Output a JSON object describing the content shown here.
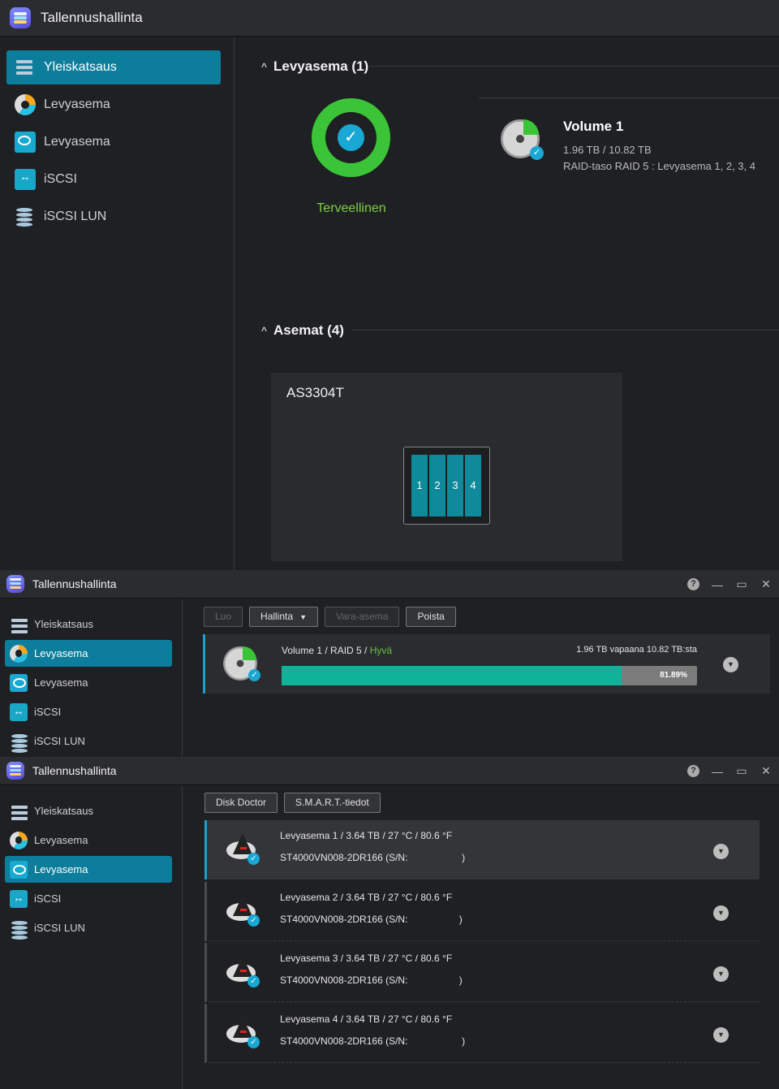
{
  "app_title": "Tallennushallinta",
  "nav": [
    "Yleiskatsaus",
    "Levyasema",
    "Levyasema",
    "iSCSI",
    "iSCSI LUN"
  ],
  "overview": {
    "volumes_header": "Levyasema (1)",
    "health_label": "Terveellinen",
    "volume_name": "Volume 1",
    "volume_capacity": "1.96 TB / 10.82 TB",
    "volume_raid": "RAID-taso RAID 5 : Levyasema 1, 2, 3, 4",
    "drives_header": "Asemat (4)",
    "nas_model": "AS3304T",
    "bays": [
      "1",
      "2",
      "3",
      "4"
    ]
  },
  "volume_panel": {
    "buttons": [
      "Luo",
      "Hallinta",
      "Vara-asema",
      "Poista"
    ],
    "volume_label": "Volume 1 / RAID 5 / ",
    "volume_status": "Hyvä",
    "free_text": "1.96 TB vapaana 10.82 TB:sta",
    "usage_percent_label": "81.89%",
    "usage_fraction": 0.8189
  },
  "disk_panel": {
    "buttons": [
      "Disk Doctor",
      "S.M.A.R.T.-tiedot"
    ],
    "disks": [
      {
        "title": "Levyasema 1 / 3.64 TB / 27 °C / 80.6 °F",
        "model": "ST4000VN008-2DR166 (S/N:                    )"
      },
      {
        "title": "Levyasema 2 / 3.64 TB / 27 °C / 80.6 °F",
        "model": "ST4000VN008-2DR166 (S/N:                   )"
      },
      {
        "title": "Levyasema 3 / 3.64 TB / 27 °C / 80.6 °F",
        "model": "ST4000VN008-2DR166 (S/N:                   )"
      },
      {
        "title": "Levyasema 4 / 3.64 TB / 27 °C / 80.6 °F",
        "model": "ST4000VN008-2DR166 (S/N:                    )"
      }
    ]
  },
  "window_controls": {
    "help": "?",
    "minimize": "—",
    "maximize": "▭",
    "close": "✕"
  },
  "colors": {
    "accent": "#0c7e9c",
    "healthy": "#3bc437",
    "bar_fill": "#10b39a"
  }
}
